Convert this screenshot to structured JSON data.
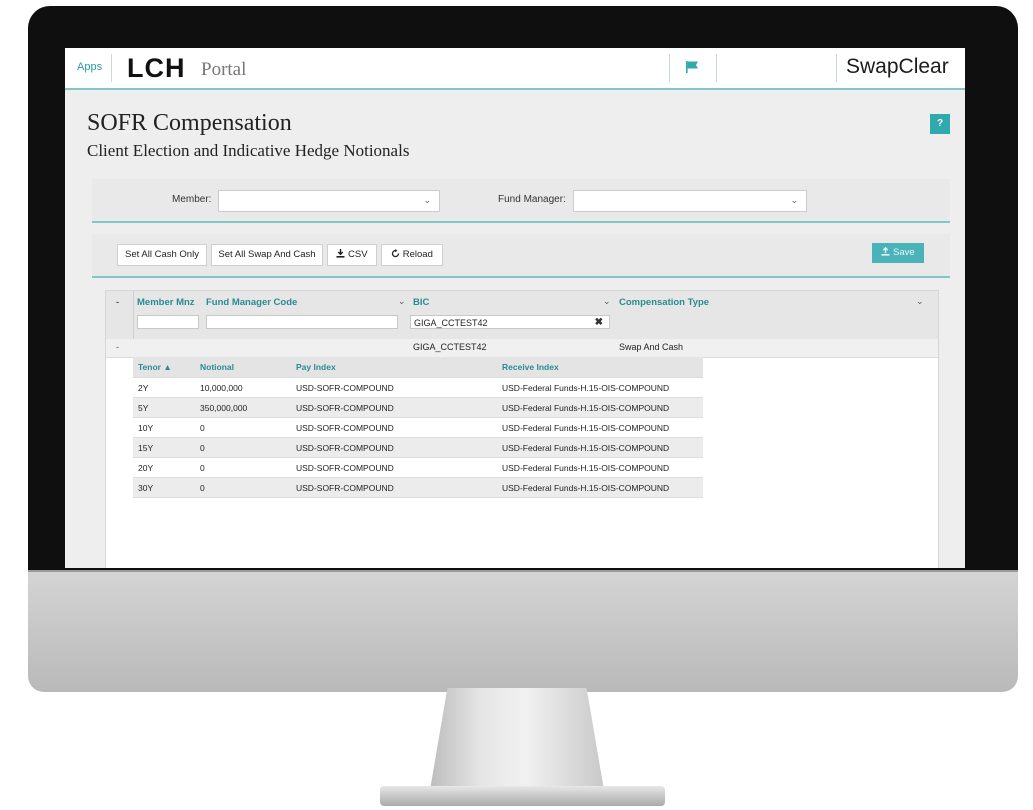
{
  "header": {
    "apps_label": "Apps",
    "logo_text": "LCH",
    "portal_text": "Portal",
    "brand": "SwapClear"
  },
  "page": {
    "title": "SOFR Compensation",
    "subtitle": "Client Election and Indicative Hedge Notionals",
    "help_label": "?"
  },
  "filters": {
    "member_label": "Member:",
    "member_value": "",
    "fund_manager_label": "Fund Manager:",
    "fund_manager_value": ""
  },
  "toolbar": {
    "set_all_cash_only": "Set All Cash Only",
    "set_all_swap_and_cash": "Set All Swap And Cash",
    "csv": "CSV",
    "reload": "Reload",
    "save": "Save"
  },
  "grid": {
    "expand_all_symbol": "-",
    "columns": {
      "member_mnemonic": "Member Mnz",
      "fund_manager_code": "Fund Manager Code",
      "bic": "BIC",
      "compensation_type": "Compensation Type"
    },
    "filter_values": {
      "member_mnemonic": "",
      "fund_manager_code": "",
      "bic": "GIGA_CCTEST42"
    },
    "row": {
      "expand_symbol": "-",
      "member_mnemonic": "",
      "fund_manager_code": "",
      "bic": "GIGA_CCTEST42",
      "compensation_type": "Swap And Cash"
    },
    "detail": {
      "headers": {
        "tenor": "Tenor ▲",
        "notional": "Notional",
        "pay_index": "Pay Index",
        "receive_index": "Receive Index"
      },
      "rows": [
        {
          "tenor": "2Y",
          "notional": "10,000,000",
          "pay_index": "USD-SOFR-COMPOUND",
          "receive_index": "USD-Federal Funds-H.15-OIS-COMPOUND"
        },
        {
          "tenor": "5Y",
          "notional": "350,000,000",
          "pay_index": "USD-SOFR-COMPOUND",
          "receive_index": "USD-Federal Funds-H.15-OIS-COMPOUND"
        },
        {
          "tenor": "10Y",
          "notional": "0",
          "pay_index": "USD-SOFR-COMPOUND",
          "receive_index": "USD-Federal Funds-H.15-OIS-COMPOUND"
        },
        {
          "tenor": "15Y",
          "notional": "0",
          "pay_index": "USD-SOFR-COMPOUND",
          "receive_index": "USD-Federal Funds-H.15-OIS-COMPOUND"
        },
        {
          "tenor": "20Y",
          "notional": "0",
          "pay_index": "USD-SOFR-COMPOUND",
          "receive_index": "USD-Federal Funds-H.15-OIS-COMPOUND"
        },
        {
          "tenor": "30Y",
          "notional": "0",
          "pay_index": "USD-SOFR-COMPOUND",
          "receive_index": "USD-Federal Funds-H.15-OIS-COMPOUND"
        }
      ]
    }
  },
  "icons": {
    "flag": "flag-icon",
    "download": "download-icon",
    "reload": "reload-icon",
    "upload": "upload-icon",
    "chevron": "chevron-down-icon",
    "clear": "close-icon"
  },
  "colors": {
    "accent": "#2fa9ae",
    "header_text": "#2b8a92",
    "accent_line": "#7ec9c6"
  }
}
